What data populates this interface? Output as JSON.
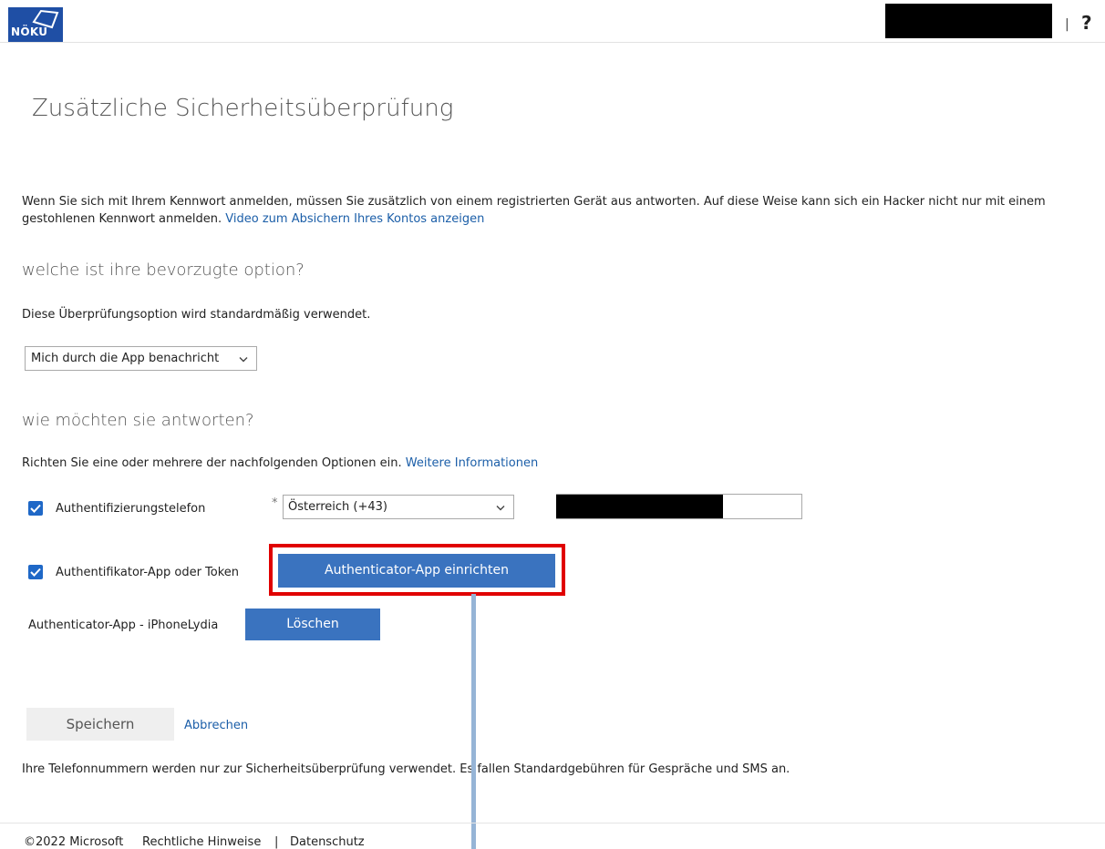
{
  "header": {
    "logo_text": "NÖKU",
    "divider": "|",
    "help_glyph": "?"
  },
  "page": {
    "title": "Zusätzliche Sicherheitsüberprüfung",
    "intro_text": "Wenn Sie sich mit Ihrem Kennwort anmelden, müssen Sie zusätzlich von einem registrierten Gerät aus antworten. Auf diese Weise kann sich ein Hacker nicht nur mit einem gestohlenen Kennwort anmelden.",
    "intro_link": "Video zum Absichern Ihres Kontos anzeigen"
  },
  "preferred": {
    "heading": "welche ist ihre bevorzugte option?",
    "description": "Diese Überprüfungsoption wird standardmäßig verwendet.",
    "selected_option": "Mich durch die App benachricht"
  },
  "respond": {
    "heading": "wie möchten sie antworten?",
    "description": "Richten Sie eine oder mehrere der nachfolgenden Optionen ein.",
    "more_info_link": "Weitere Informationen",
    "phone": {
      "label": "Authentifizierungstelefon",
      "checked": true,
      "required_marker": "*",
      "country_selected": "Österreich (+43)"
    },
    "app": {
      "label": "Authentifikator-App oder Token",
      "checked": true,
      "setup_button": "Authenticator-App einrichten"
    },
    "device": {
      "label": "Authenticator-App - iPhoneLydia",
      "delete_button": "Löschen"
    }
  },
  "actions": {
    "save": "Speichern",
    "cancel": "Abbrechen"
  },
  "notice": "Ihre Telefonnummern werden nur zur Sicherheitsüberprüfung verwendet. Es fallen Standardgebühren für Gespräche und SMS an.",
  "footer": {
    "copyright": "©2022 Microsoft",
    "legal": "Rechtliche Hinweise",
    "separator": "|",
    "privacy": "Datenschutz"
  },
  "colors": {
    "accent_blue": "#3a73bf",
    "link_blue": "#1b5ea8",
    "checkbox_blue": "#1f68c7",
    "highlight_red": "#e00000"
  }
}
